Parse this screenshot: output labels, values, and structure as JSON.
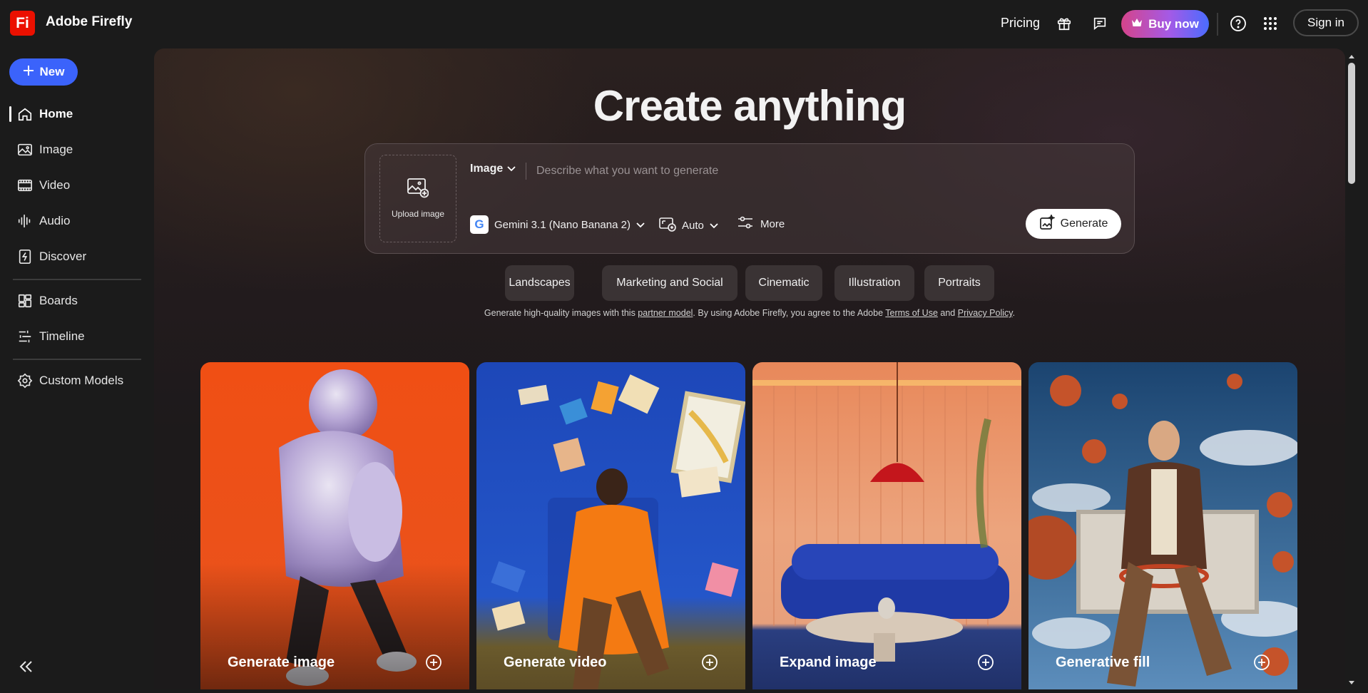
{
  "header": {
    "app_title": "Adobe Firefly",
    "logo_text": "Fi",
    "pricing_label": "Pricing",
    "buy_label": "Buy now",
    "signin_label": "Sign in",
    "icons": [
      "gift-icon",
      "chat-icon",
      "crown-icon",
      "help-icon",
      "apps-grid-icon"
    ]
  },
  "sidebar": {
    "new_label": "New",
    "items": [
      {
        "label": "Home",
        "icon": "home-icon",
        "active": true
      },
      {
        "label": "Image",
        "icon": "image-icon"
      },
      {
        "label": "Video",
        "icon": "video-icon"
      },
      {
        "label": "Audio",
        "icon": "audio-icon"
      },
      {
        "label": "Discover",
        "icon": "discover-icon"
      },
      {
        "label": "Boards",
        "icon": "boards-icon"
      },
      {
        "label": "Timeline",
        "icon": "timeline-icon"
      },
      {
        "label": "Custom Models",
        "icon": "custom-models-icon"
      }
    ]
  },
  "main": {
    "hero_title": "Create anything",
    "prompt": {
      "upload_label": "Upload image",
      "type_value": "Image",
      "placeholder": "Describe what you want to generate",
      "model_value": "Gemini 3.1 (Nano Banana 2)",
      "model_badge": "G",
      "ratio_value": "Auto",
      "more_label": "More",
      "generate_label": "Generate"
    },
    "chips": [
      "Landscapes",
      "Marketing and Social",
      "Cinematic",
      "Illustration",
      "Portraits"
    ],
    "legal": {
      "part1": "Generate high-quality images with this ",
      "link1": "partner model",
      "part2": ". By using Adobe Firefly, you agree to the Adobe ",
      "link2": "Terms of Use",
      "part3": " and ",
      "link3": "Privacy Policy",
      "part4": "."
    },
    "cards": [
      {
        "label": "Generate image"
      },
      {
        "label": "Generate video"
      },
      {
        "label": "Expand image"
      },
      {
        "label": "Generative fill"
      }
    ]
  },
  "colors": {
    "accent_blue": "#3b63fb",
    "logo_red": "#eb1000",
    "bg_dark": "#1b1b1b"
  }
}
